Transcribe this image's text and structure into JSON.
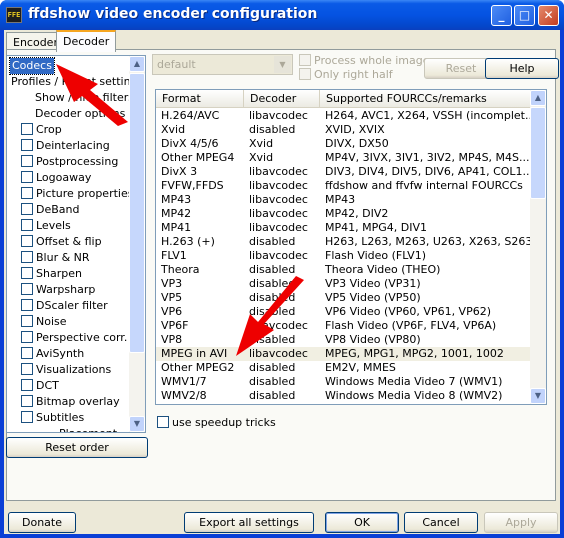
{
  "window": {
    "title": "ffdshow video encoder configuration",
    "icon_text": "FFE",
    "colors": {
      "title_blue": "#0553e2",
      "close_red": "#c43d1f",
      "selection": "#316ac5",
      "annotation_arrow": "#ee0000"
    }
  },
  "tabs": [
    {
      "label": "Encoder",
      "active": false
    },
    {
      "label": "Decoder",
      "active": true
    }
  ],
  "sidebar": {
    "items": [
      {
        "label": "Codecs",
        "selected": true
      },
      {
        "label": "Profiles / Preset settings"
      },
      {
        "label": "Show / hide filters"
      },
      {
        "label": "Decoder options"
      },
      {
        "label": "Crop",
        "checkbox": true
      },
      {
        "label": "Deinterlacing",
        "checkbox": true
      },
      {
        "label": "Postprocessing",
        "checkbox": true
      },
      {
        "label": "Logoaway",
        "checkbox": true
      },
      {
        "label": "Picture properties",
        "checkbox": true
      },
      {
        "label": "DeBand",
        "checkbox": true
      },
      {
        "label": "Levels",
        "checkbox": true
      },
      {
        "label": "Offset & flip",
        "checkbox": true
      },
      {
        "label": "Blur & NR",
        "checkbox": true
      },
      {
        "label": "Sharpen",
        "checkbox": true
      },
      {
        "label": "Warpsharp",
        "checkbox": true
      },
      {
        "label": "DScaler filter",
        "checkbox": true
      },
      {
        "label": "Noise",
        "checkbox": true
      },
      {
        "label": "Perspective corr.",
        "checkbox": true
      },
      {
        "label": "AviSynth",
        "checkbox": true
      },
      {
        "label": "Visualizations",
        "checkbox": true
      },
      {
        "label": "DCT",
        "checkbox": true
      },
      {
        "label": "Bitmap overlay",
        "checkbox": true
      },
      {
        "label": "Subtitles",
        "checkbox": true
      },
      {
        "label": "Placement"
      }
    ],
    "reset_order_label": "Reset order"
  },
  "preset": {
    "value": "default",
    "process_whole_image_label": "Process whole image",
    "only_right_half_label": "Only right half",
    "reset_label": "Reset",
    "help_label": "Help"
  },
  "codecs_table": {
    "columns": [
      "Format",
      "Decoder",
      "Supported FOURCCs/remarks"
    ],
    "rows": [
      [
        "H.264/AVC",
        "libavcodec",
        "H264, AVC1, X264, VSSH (incomplet..."
      ],
      [
        "Xvid",
        "disabled",
        "XVID, XVIX"
      ],
      [
        "DivX 4/5/6",
        "Xvid",
        "DIVX, DX50"
      ],
      [
        "Other MPEG4",
        "Xvid",
        "MP4V, 3IVX, 3IV1, 3IV2, MP4S, M4S..."
      ],
      [
        "DivX 3",
        "libavcodec",
        "DIV3, DIV4, DIV5, DIV6, AP41, COL1..."
      ],
      [
        "FVFW,FFDS",
        "libavcodec",
        "ffdshow and ffvfw internal FOURCCs"
      ],
      [
        "MP43",
        "libavcodec",
        "MP43"
      ],
      [
        "MP42",
        "libavcodec",
        "MP42, DIV2"
      ],
      [
        "MP41",
        "libavcodec",
        "MP41, MPG4, DIV1"
      ],
      [
        "H.263 (+)",
        "disabled",
        "H263, L263, M263, U263, X263, S263..."
      ],
      [
        "FLV1",
        "libavcodec",
        "Flash Video (FLV1)"
      ],
      [
        "Theora",
        "disabled",
        "Theora Video (THEO)"
      ],
      [
        "VP3",
        "disabled",
        "VP3 Video (VP31)"
      ],
      [
        "VP5",
        "disabled",
        "VP5 Video (VP50)"
      ],
      [
        "VP6",
        "disabled",
        "VP6 Video (VP60, VP61, VP62)"
      ],
      [
        "VP6F",
        "libavcodec",
        "Flash Video (VP6F, FLV4, VP6A)"
      ],
      [
        "VP8",
        "disabled",
        "VP8 Video (VP80)"
      ],
      [
        "MPEG in AVI",
        "libavcodec",
        "MPEG, MPG1, MPG2, 1001, 1002"
      ],
      [
        "Other MPEG2",
        "disabled",
        "EM2V, MMES"
      ],
      [
        "WMV1/7",
        "disabled",
        "Windows Media Video 7 (WMV1)"
      ],
      [
        "WMV2/8",
        "disabled",
        "Windows Media Video 8 (WMV2)"
      ]
    ],
    "highlighted_row": 17
  },
  "speedup_label": "use speedup tricks",
  "footer": {
    "donate_label": "Donate",
    "export_label": "Export all settings",
    "ok_label": "OK",
    "cancel_label": "Cancel",
    "apply_label": "Apply"
  }
}
